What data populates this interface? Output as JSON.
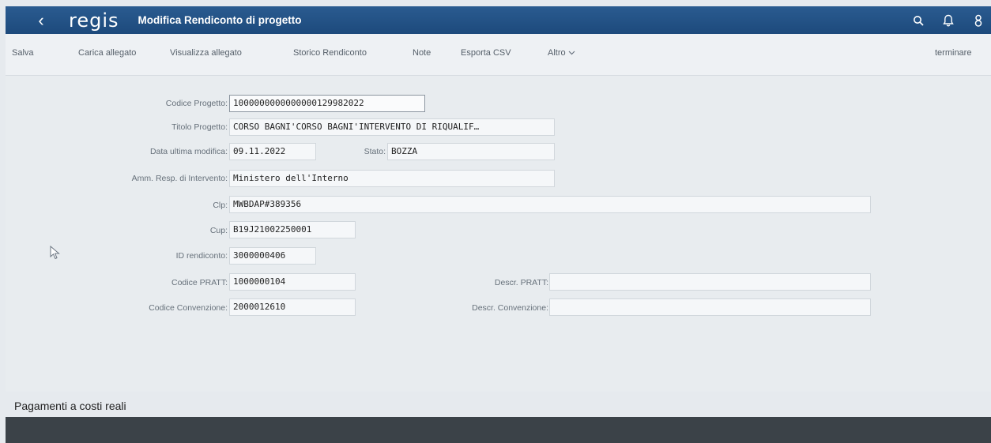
{
  "shell": {
    "back_glyph": "‹",
    "logo": "regis",
    "title": "Modifica Rendiconto di progetto",
    "icons": [
      "search-icon",
      "bell-icon",
      "user-icon"
    ]
  },
  "toolbar": {
    "salva": "Salva",
    "carica": "Carica allegato",
    "visualizza": "Visualizza allegato",
    "storico": "Storico Rendiconto",
    "note": "Note",
    "esporta": "Esporta CSV",
    "altro": "Altro",
    "terminare": "terminare"
  },
  "form": {
    "codice_progetto": {
      "label": "Codice Progetto:",
      "value": "1000000000000000129982022"
    },
    "titolo_progetto": {
      "label": "Titolo Progetto:",
      "value": "CORSO BAGNI'CORSO BAGNI'INTERVENTO DI RIQUALIF…"
    },
    "data_modifica": {
      "label": "Data ultima modifica:",
      "value": "09.11.2022"
    },
    "stato": {
      "label": "Stato:",
      "value": "BOZZA"
    },
    "amm_resp": {
      "label": "Amm. Resp. di Intervento:",
      "value": "Ministero dell'Interno"
    },
    "clp": {
      "label": "Clp:",
      "value": "MWBDAP#389356"
    },
    "cup": {
      "label": "Cup:",
      "value": "B19J21002250001"
    },
    "id_rendiconto": {
      "label": "ID rendiconto:",
      "value": "3000000406"
    },
    "codice_pratt": {
      "label": "Codice PRATT:",
      "value": "1000000104"
    },
    "descr_pratt": {
      "label": "Descr. PRATT:",
      "value": ""
    },
    "codice_convenzione": {
      "label": "Codice Convenzione:",
      "value": "2000012610"
    },
    "descr_convenzione": {
      "label": "Descr. Convenzione:",
      "value": ""
    }
  },
  "section": {
    "title": "Pagamenti a costi reali"
  },
  "colors": {
    "shell": "#1d4a7c",
    "background": "#e6eaee",
    "dark_bar": "#3b4248"
  }
}
